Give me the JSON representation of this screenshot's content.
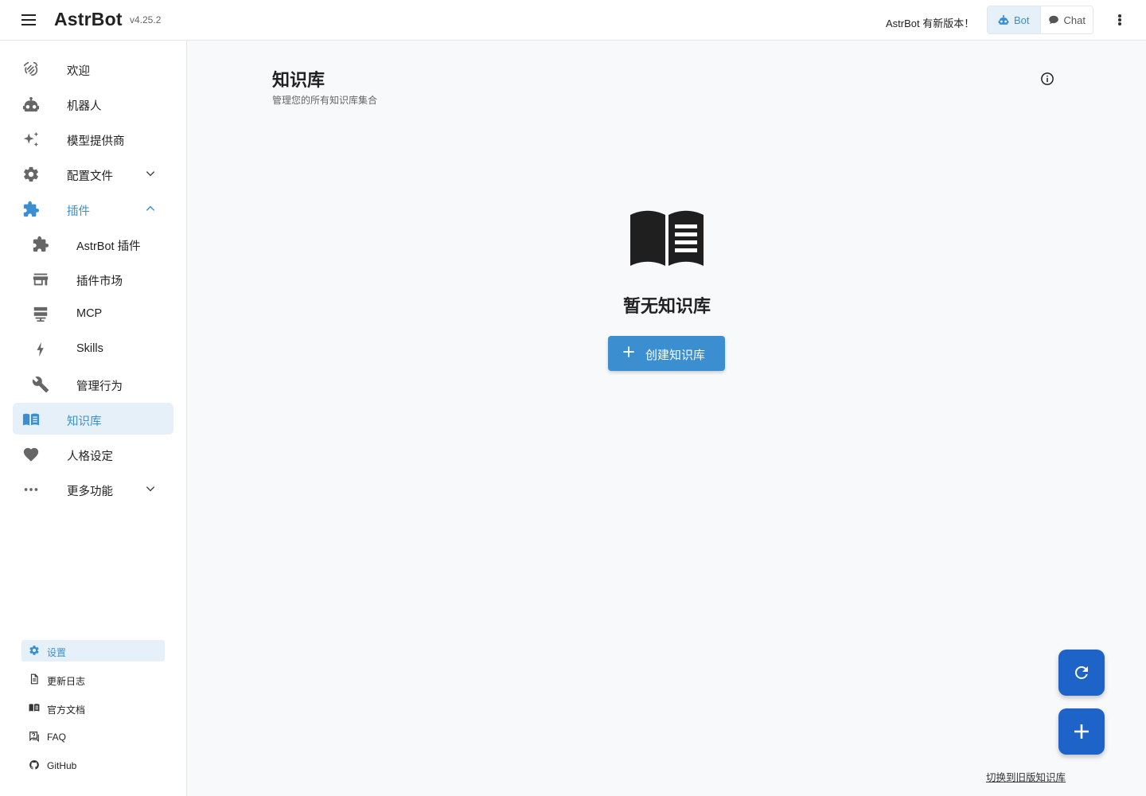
{
  "header": {
    "brand": "AstrBot",
    "version": "v4.25.2",
    "update_note": "AstrBot 有新版本！",
    "modes": [
      {
        "label": "Bot",
        "active": true
      },
      {
        "label": "Chat",
        "active": false
      }
    ]
  },
  "sidebar": {
    "items": [
      {
        "label": "欢迎",
        "icon": "hand-wave-icon"
      },
      {
        "label": "机器人",
        "icon": "robot-icon"
      },
      {
        "label": "模型提供商",
        "icon": "sparkle-icon"
      },
      {
        "label": "配置文件",
        "icon": "gear-icon"
      },
      {
        "label": "插件",
        "icon": "puzzle-icon"
      },
      {
        "label": "AstrBot 插件",
        "icon": "puzzle-icon"
      },
      {
        "label": "插件市场",
        "icon": "store-icon"
      },
      {
        "label": "MCP",
        "icon": "server-icon"
      },
      {
        "label": "Skills",
        "icon": "lightning-icon"
      },
      {
        "label": "管理行为",
        "icon": "wrench-icon"
      },
      {
        "label": "知识库",
        "icon": "book-icon"
      },
      {
        "label": "人格设定",
        "icon": "heart-icon"
      },
      {
        "label": "更多功能",
        "icon": "dots-icon"
      }
    ],
    "footer": [
      {
        "label": "设置",
        "icon": "gear-icon"
      },
      {
        "label": "更新日志",
        "icon": "document-icon"
      },
      {
        "label": "官方文档",
        "icon": "book-icon"
      },
      {
        "label": "FAQ",
        "icon": "faq-icon"
      },
      {
        "label": "GitHub",
        "icon": "github-icon"
      }
    ]
  },
  "main": {
    "title": "知识库",
    "subtitle": "管理您的所有知识库集合",
    "empty_text": "暂无知识库",
    "create_button": "创建知识库",
    "old_link": "切换到旧版知识库"
  },
  "colors": {
    "accent": "#3b8fd0",
    "fab": "#1e63c8",
    "active_bg": "#e6f0f8"
  }
}
